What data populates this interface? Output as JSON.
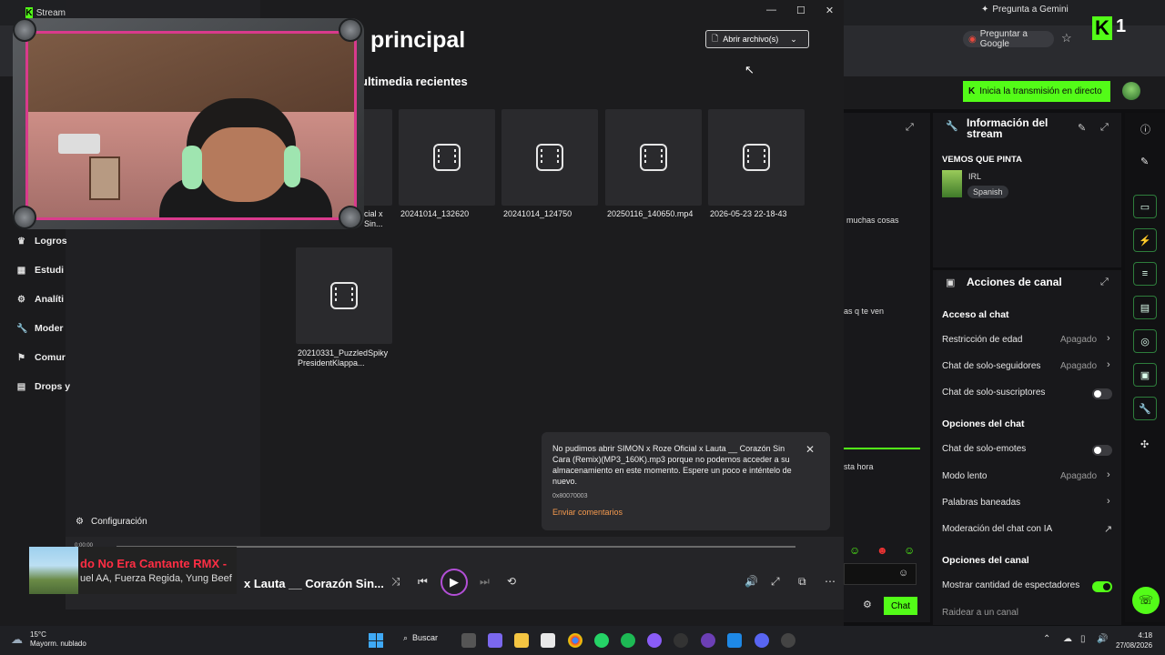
{
  "browser": {
    "tab_title": "Stream",
    "ask_gemini": "Pregunta a Gemini",
    "ask_google": "Preguntar a Google",
    "kick_count": "1"
  },
  "dashboard": {
    "go_live": "Inicia la transmisión en directo",
    "stream_info_title": "Información del stream",
    "stream_title": "VEMOS QUE PINTA",
    "category": "IRL",
    "language_tag": "Spanish",
    "chat_snippets": [
      "muchas cosas",
      "as q te ven",
      "sta hora"
    ],
    "actions_title": "Acciones de canal",
    "chat_access_header": "Acceso al chat",
    "age_restriction": {
      "label": "Restricción de edad",
      "value": "Apagado"
    },
    "followers_only": {
      "label": "Chat de solo-seguidores",
      "value": "Apagado"
    },
    "subscribers_only": {
      "label": "Chat de solo-suscriptores"
    },
    "chat_options_header": "Opciones del chat",
    "emotes_only": {
      "label": "Chat de solo-emotes"
    },
    "slow_mode": {
      "label": "Modo lento",
      "value": "Apagado"
    },
    "banned_words": {
      "label": "Palabras baneadas"
    },
    "ai_moderation": {
      "label": "Moderación del chat con IA"
    },
    "channel_options_header": "Opciones del canal",
    "show_viewers": {
      "label": "Mostrar cantidad de espectadores"
    },
    "raid": "Raidear a un canal",
    "chat_button": "Chat"
  },
  "player": {
    "title": "principal",
    "subtitle": "ultimedia recientes",
    "open_files": "Abrir archivo(s)",
    "sidebar": [
      {
        "label": "Logros",
        "icon": "trophy-icon"
      },
      {
        "label": "Estudi",
        "icon": "grid-icon"
      },
      {
        "label": "Analíti",
        "icon": "analytics-icon"
      },
      {
        "label": "Moder",
        "icon": "wrench-icon"
      },
      {
        "label": "Comur",
        "icon": "community-icon"
      },
      {
        "label": "Drops y",
        "icon": "drops-icon"
      }
    ],
    "settings": "Configuración",
    "tiles": [
      {
        "caption": "cial x\nSin..."
      },
      {
        "caption": "20241014_132620"
      },
      {
        "caption": "20241014_124750"
      },
      {
        "caption": "20250116_140650.mp4"
      },
      {
        "caption": "2026-05-23 22-18-43"
      },
      {
        "caption": "20210331_PuzzledSpiky\nPresidentKlappa..."
      }
    ],
    "toast": {
      "message": "No pudimos abrir SIMON x Roze Oficial x Lauta __ Corazón Sin Cara (Remix)(MP3_160K).mp3 porque no podemos acceder a su almacenamiento en este momento. Espere un poco e inténtelo de nuevo.",
      "code": "0x80070003",
      "feedback": "Enviar comentarios"
    },
    "now_playing": "x Lauta __ Corazón Sin...",
    "time": "0:00:00"
  },
  "overlay_song": {
    "title": "do No Era Cantante RMX -",
    "artists": "uel AA, Fuerza Regida, Yung Beef"
  },
  "taskbar": {
    "temp": "15°C",
    "weather": "Mayorm. nublado",
    "search": "Buscar",
    "time": "4:18",
    "date": "27/08/2026"
  }
}
